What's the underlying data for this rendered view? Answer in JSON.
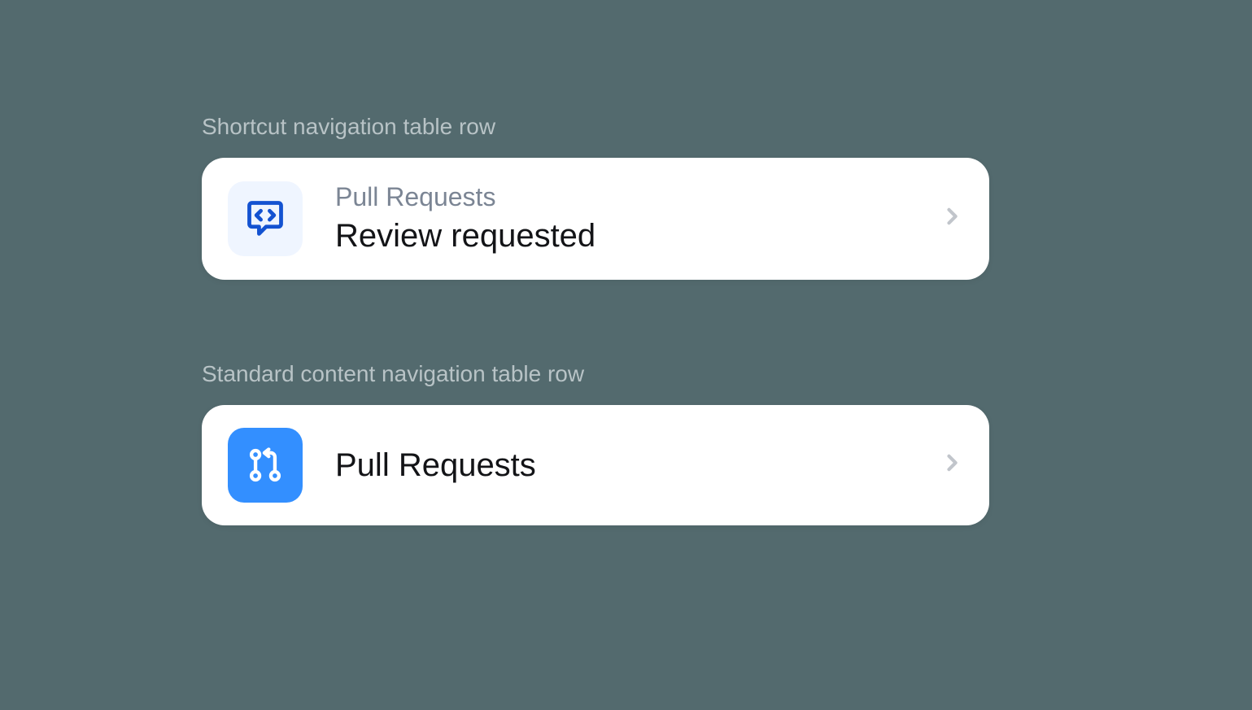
{
  "sections": {
    "shortcut": {
      "label": "Shortcut navigation table row",
      "overline": "Pull Requests",
      "title": "Review requested"
    },
    "standard": {
      "label": "Standard content navigation table row",
      "title": "Pull Requests"
    }
  }
}
